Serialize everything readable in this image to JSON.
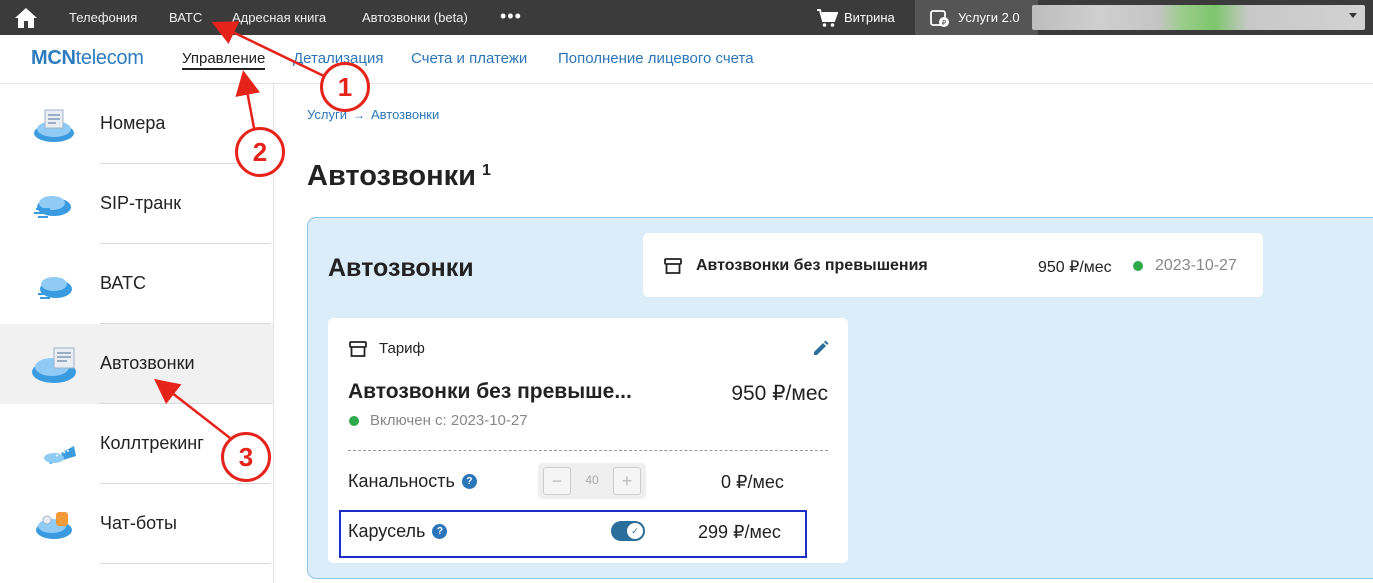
{
  "topbar": {
    "nav": [
      "Телефония",
      "ВАТС",
      "Адресная книга",
      "Автозвонки (beta)"
    ],
    "more": "•••",
    "shop_label": "Витрина",
    "services_label": "Услуги 2.0"
  },
  "subbar": {
    "logo_bold": "MCN",
    "logo_rest": "telecom",
    "nav": [
      "Управление",
      "Детализация",
      "Счета и платежи",
      "Пополнение лицевого счета"
    ],
    "active": "Управление"
  },
  "sidebar": {
    "items": [
      {
        "label": "Номера",
        "icon": "numbers-icon"
      },
      {
        "label": "SIP-транк",
        "icon": "sip-trunk-icon"
      },
      {
        "label": "ВАТС",
        "icon": "vats-icon"
      },
      {
        "label": "Автозвонки",
        "icon": "autocalls-icon",
        "active": true
      },
      {
        "label": "Коллтрекинг",
        "icon": "calltracking-icon"
      },
      {
        "label": "Чат-боты",
        "icon": "chatbots-icon"
      }
    ]
  },
  "breadcrumb": {
    "root": "Услуги",
    "current": "Автозвонки"
  },
  "page": {
    "title": "Автозвонки",
    "title_sup": "1"
  },
  "panel": {
    "title": "Автозвонки",
    "summary": {
      "name": "Автозвонки без превышения",
      "price": "950 ₽/мес",
      "date": "2023-10-27"
    },
    "card": {
      "tariff_label": "Тариф",
      "tariff_name": "Автозвонки без превыше...",
      "tariff_price": "950 ₽/мес",
      "since": "Включен с: 2023-10-27",
      "channels": {
        "label": "Канальность",
        "value": "40",
        "price": "0 ₽/мес"
      },
      "carousel": {
        "label": "Карусель",
        "price": "299 ₽/мес",
        "enabled": true
      }
    }
  },
  "annotations": {
    "badges": [
      "1",
      "2",
      "3"
    ],
    "color": "#e6231b"
  },
  "colors": {
    "accent": "#2b76b9",
    "status_green": "#2ea94a",
    "panel_bg": "#dbedf8",
    "highlight": "#1b2fc7"
  }
}
